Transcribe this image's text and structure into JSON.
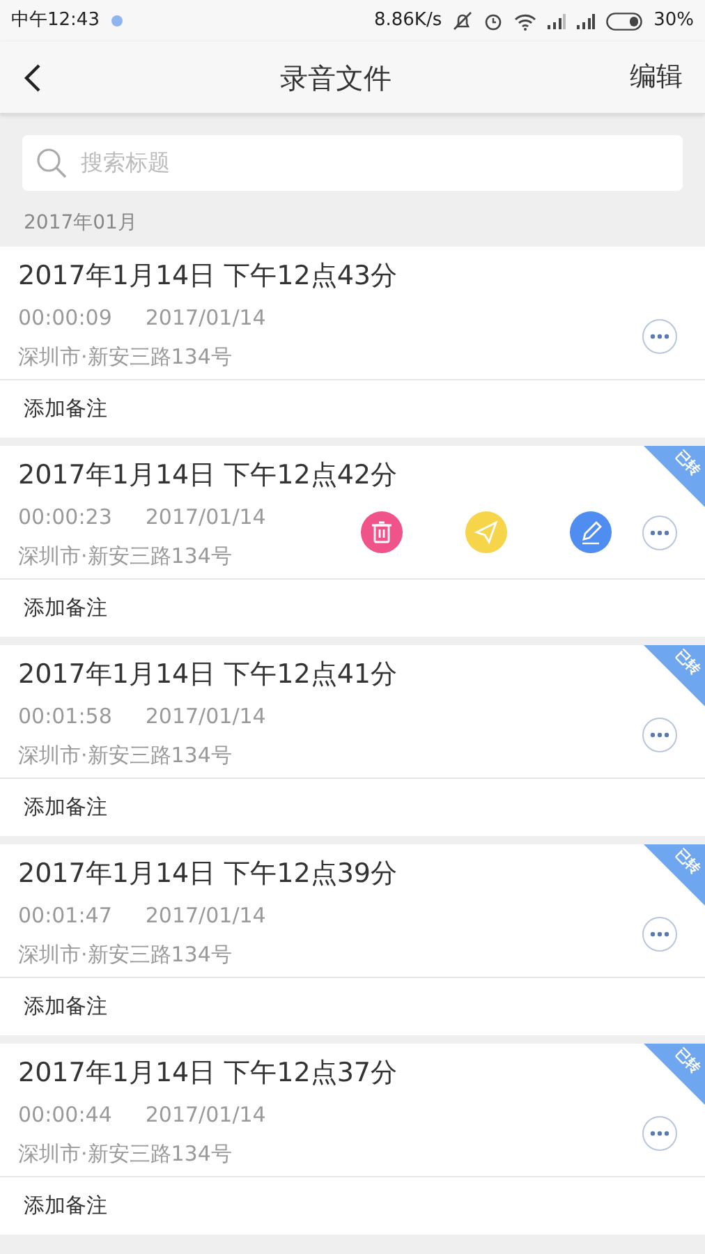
{
  "status_bar": {
    "time": "中午12:43",
    "speed": "8.86K/s",
    "battery": "30%"
  },
  "header": {
    "title": "录音文件",
    "edit": "编辑"
  },
  "search": {
    "placeholder": "搜索标题"
  },
  "group": "2017年01月",
  "recordings": [
    {
      "title": "2017年1月14日 下午12点43分",
      "duration": "00:00:09",
      "date": "2017/01/14",
      "address": "深圳市·新安三路134号",
      "note": "添加备注",
      "actions_shown": false
    },
    {
      "title": "2017年1月14日 下午12点42分",
      "duration": "00:00:23",
      "date": "2017/01/14",
      "address": "深圳市·新安三路134号",
      "note": "添加备注",
      "badge": "已转",
      "actions_shown": true
    },
    {
      "title": "2017年1月14日 下午12点41分",
      "duration": "00:01:58",
      "date": "2017/01/14",
      "address": "深圳市·新安三路134号",
      "note": "添加备注",
      "badge": "已转",
      "actions_shown": false
    },
    {
      "title": "2017年1月14日 下午12点39分",
      "duration": "00:01:47",
      "date": "2017/01/14",
      "address": "深圳市·新安三路134号",
      "note": "添加备注",
      "badge": "已转",
      "actions_shown": false
    },
    {
      "title": "2017年1月14日 下午12点37分",
      "duration": "00:00:44",
      "date": "2017/01/14",
      "address": "深圳市·新安三路134号",
      "note": "添加备注",
      "badge": "已转",
      "actions_shown": false
    }
  ]
}
